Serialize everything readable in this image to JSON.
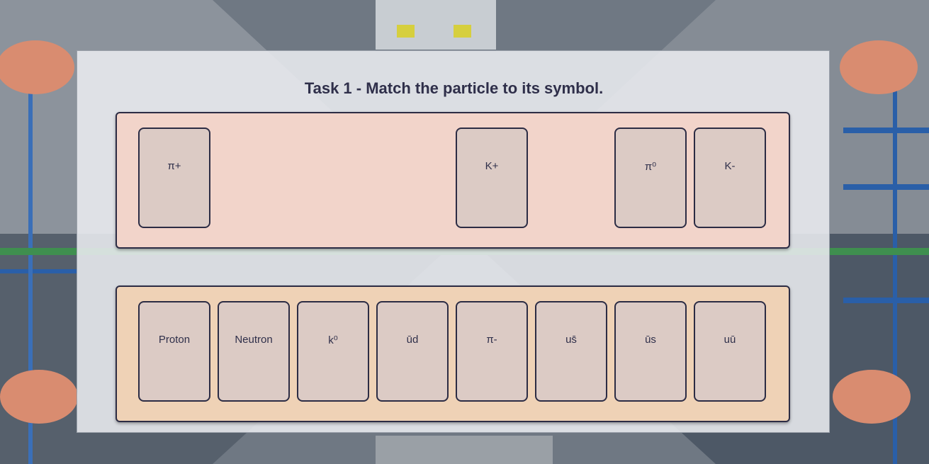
{
  "task": {
    "title": "Task 1 - Match the particle to its symbol."
  },
  "top_zone": {
    "cards": [
      {
        "label": "π+"
      },
      {
        "label": "K+"
      },
      {
        "label": "π⁰"
      },
      {
        "label": "K-"
      }
    ]
  },
  "bottom_zone": {
    "cards": [
      {
        "label": "Proton"
      },
      {
        "label": "Neutron"
      },
      {
        "label": "k⁰"
      },
      {
        "label": "ūd"
      },
      {
        "label": "π-"
      },
      {
        "label": "us̄"
      },
      {
        "label": "ūs"
      },
      {
        "label": "uū"
      }
    ]
  },
  "colors": {
    "top_zone_bg": "#f2d4ca",
    "bottom_zone_bg": "#efd2b6",
    "card_bg": "#dccbc5",
    "border": "#2c2c44",
    "title_text": "#2f2f4a"
  }
}
